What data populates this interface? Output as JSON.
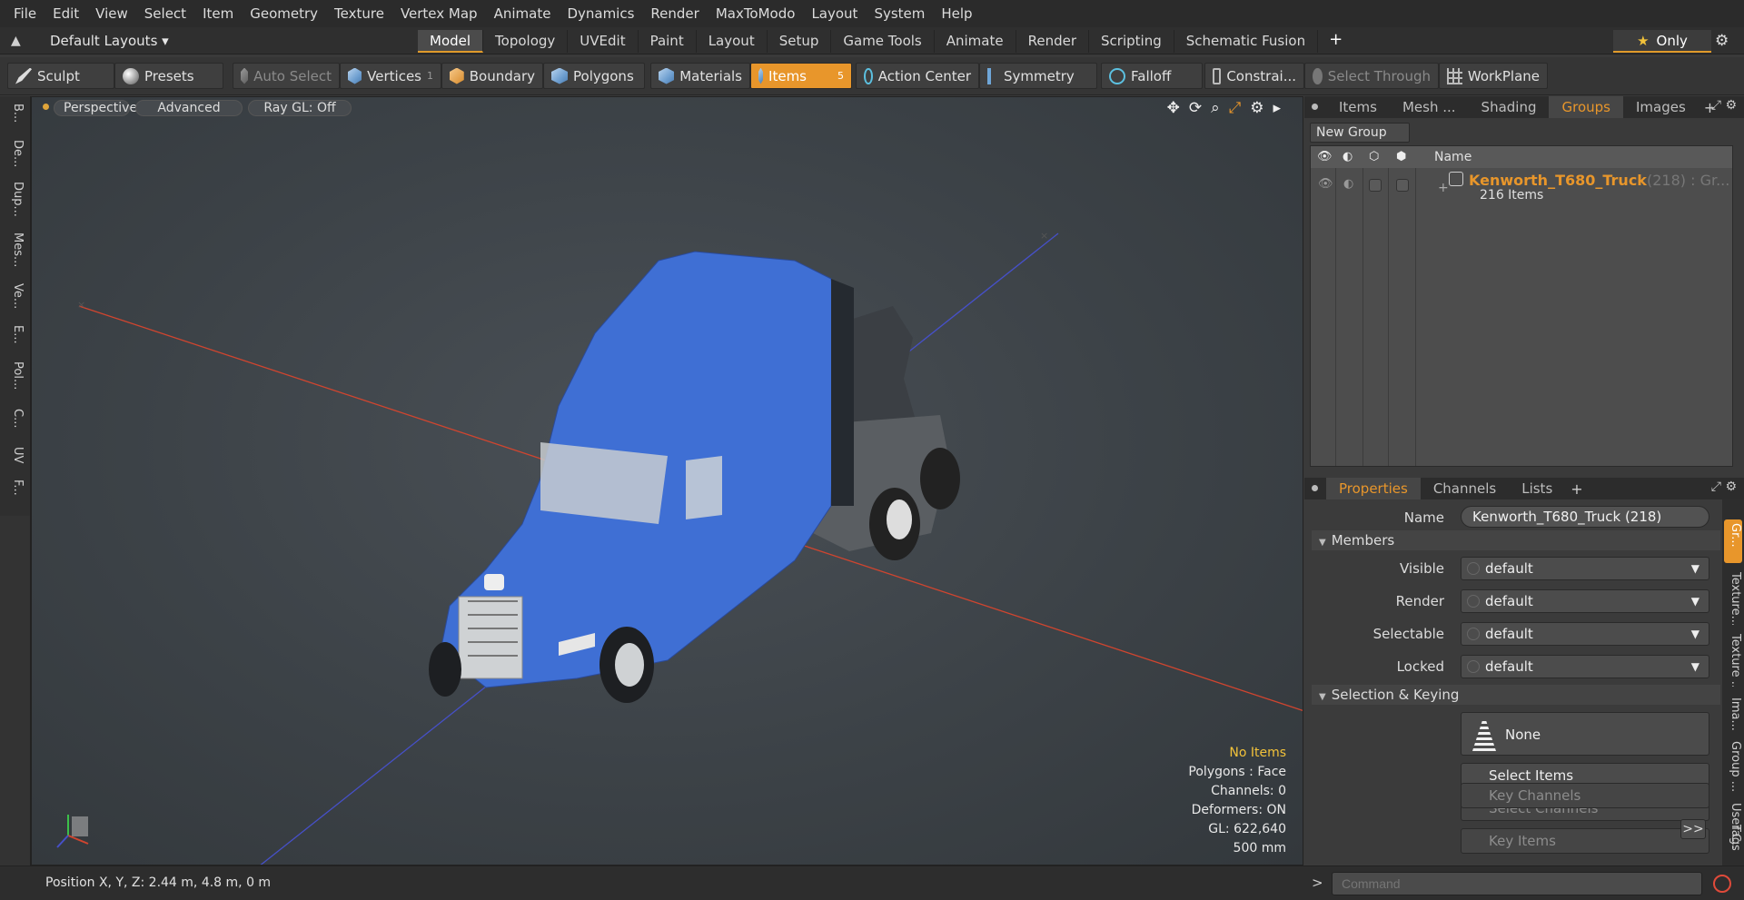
{
  "menu": [
    "File",
    "Edit",
    "View",
    "Select",
    "Item",
    "Geometry",
    "Texture",
    "Vertex Map",
    "Animate",
    "Dynamics",
    "Render",
    "MaxToModo",
    "Layout",
    "System",
    "Help"
  ],
  "layouts": {
    "default_label": "Default Layouts ▾",
    "tabs": [
      "Model",
      "Topology",
      "UVEdit",
      "Paint",
      "Layout",
      "Setup",
      "Game Tools",
      "Animate",
      "Render",
      "Scripting",
      "Schematic Fusion"
    ],
    "active_tab": "Model",
    "only_label": "Only"
  },
  "toolbar": {
    "sculpt": "Sculpt",
    "presets": "Presets",
    "auto_select": "Auto Select",
    "vertices": "Vertices",
    "vertices_count": "1",
    "boundary": "Boundary",
    "polygons": "Polygons",
    "materials": "Materials",
    "items": "Items",
    "items_count": "5",
    "action_center": "Action Center",
    "symmetry": "Symmetry",
    "falloff": "Falloff",
    "constraints": "Constrai...",
    "select_through": "Select Through",
    "workplane": "WorkPlane"
  },
  "left_tabs": [
    "B...",
    "De...",
    "Dup...",
    "Mes...",
    "Ve...",
    "E...",
    "Pol...",
    "C...",
    "UV",
    "F..."
  ],
  "viewport": {
    "perspective": "Perspective",
    "advanced": "Advanced",
    "raygl": "Ray GL: Off",
    "stats": {
      "no_items": "No Items",
      "polygons": "Polygons : Face",
      "channels": "Channels: 0",
      "deformers": "Deformers: ON",
      "gl": "GL: 622,640",
      "scale": "500 mm"
    }
  },
  "groups_panel": {
    "tabs": [
      "Items",
      "Mesh ...",
      "Shading",
      "Groups",
      "Images"
    ],
    "active_tab": "Groups",
    "new_group": "New Group",
    "name_header": "Name",
    "group": {
      "name": "Kenworth_T680_Truck",
      "count": "(218) : Gr...",
      "items": "216 Items"
    }
  },
  "props_panel": {
    "tabs": [
      "Properties",
      "Channels",
      "Lists"
    ],
    "active_tab": "Properties",
    "name_label": "Name",
    "name_value": "Kenworth_T680_Truck (218)",
    "members_section": "Members",
    "visible_label": "Visible",
    "visible_value": "default",
    "render_label": "Render",
    "render_value": "default",
    "selectable_label": "Selectable",
    "selectable_value": "default",
    "locked_label": "Locked",
    "locked_value": "default",
    "selection_section": "Selection & Keying",
    "none_label": "None",
    "select_items": "Select Items",
    "select_channels": "Select Channels",
    "key_items": "Key Items",
    "key_channels": "Key Channels",
    "more": ">>"
  },
  "right_vtabs": [
    "Gr...",
    "Texture...",
    "Texture ...",
    "Ima...",
    "Group ...",
    "User C...",
    "Tags"
  ],
  "status": {
    "position": "Position X, Y, Z:   2.44 m, 4.8 m, 0 m",
    "command_placeholder": "Command"
  }
}
